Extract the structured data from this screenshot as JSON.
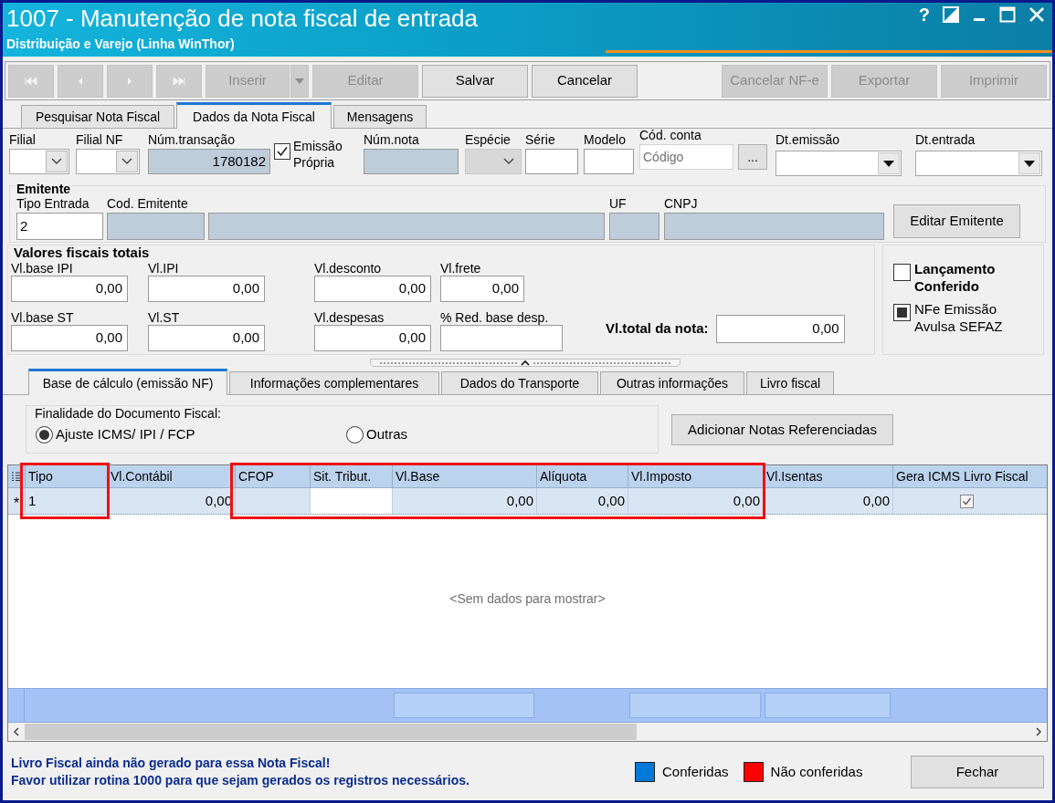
{
  "window": {
    "title": "1007 - Manutenção de nota fiscal de entrada",
    "subtitle": "Distribuição e Varejo (Linha WinThor)",
    "help": "?"
  },
  "toolbar_left": [
    {
      "kind": "first",
      "disabled": true
    },
    {
      "kind": "prev",
      "disabled": true
    },
    {
      "kind": "next",
      "disabled": true
    },
    {
      "kind": "last",
      "disabled": true
    },
    {
      "kind": "text",
      "label": "Inserir",
      "disabled": true,
      "dropdown": true
    },
    {
      "kind": "text",
      "label": "Editar",
      "disabled": true
    },
    {
      "kind": "text",
      "label": "Salvar",
      "disabled": false
    },
    {
      "kind": "text",
      "label": "Cancelar",
      "disabled": false
    }
  ],
  "toolbar_right": [
    {
      "kind": "text",
      "label": "Cancelar NF-e",
      "disabled": true
    },
    {
      "kind": "text",
      "label": "Exportar",
      "disabled": true
    },
    {
      "kind": "text",
      "label": "Imprimir",
      "disabled": true
    }
  ],
  "tabs": [
    {
      "label": "Pesquisar Nota Fiscal",
      "selected": false
    },
    {
      "label": "Dados da Nota Fiscal",
      "selected": true
    },
    {
      "label": "Mensagens",
      "selected": false
    }
  ],
  "header_fields": [
    {
      "kind": "combo",
      "label": "Filial",
      "disabled": false
    },
    {
      "kind": "combo",
      "label": "Filial NF",
      "disabled": false
    },
    {
      "kind": "text",
      "label": "Núm.transação",
      "value": "1780182",
      "readonly": true
    },
    {
      "kind": "check",
      "label": "Emissão Própria",
      "checked": true
    },
    {
      "kind": "text",
      "label": "Núm.nota",
      "readonly": true
    },
    {
      "kind": "combo",
      "label": "Espécie",
      "disabled": true
    },
    {
      "kind": "text",
      "label": "Série",
      "readonly": false
    },
    {
      "kind": "text",
      "label": "Modelo",
      "readonly": false
    },
    {
      "kind": "lookup",
      "label": "Cód. conta",
      "placeholder": "Código",
      "button": "..."
    },
    {
      "kind": "date",
      "label": "Dt.emissão"
    },
    {
      "kind": "date",
      "label": "Dt.entrada"
    }
  ],
  "emitente": {
    "title": "Emitente",
    "fields": [
      {
        "label": "Tipo Entrada",
        "value": "2",
        "readonly": false
      },
      {
        "label": "Cod. Emitente",
        "readonly": true
      },
      {
        "readonly": true
      },
      {
        "label": "UF",
        "readonly": true
      },
      {
        "label": "CNPJ",
        "readonly": true
      }
    ],
    "button": "Editar Emitente"
  },
  "valores": {
    "title": "Valores fiscais totais",
    "fields": [
      {
        "label": "Vl.base IPI",
        "value": "0,00"
      },
      {
        "label": "Vl.IPI",
        "value": "0,00"
      },
      {
        "label": "Vl.desconto",
        "value": "0,00"
      },
      {
        "label": "Vl.frete",
        "value": "0,00"
      },
      {
        "label": "Vl.base ST",
        "value": "0,00"
      },
      {
        "label": "Vl.ST",
        "value": "0,00"
      },
      {
        "label": "Vl.despesas",
        "value": "0,00"
      },
      {
        "label": "% Red. base desp."
      }
    ],
    "total_label": "Vl.total da nota:",
    "total_value": "0,00"
  },
  "flags": [
    {
      "kind": "check",
      "label": "Lançamento Conferido",
      "checked": false
    },
    {
      "kind": "fill",
      "label": "NFe Emissão Avulsa SEFAZ",
      "checked": true
    }
  ],
  "inner_tabs": [
    {
      "label": "Base de cálculo (emissão NF)",
      "selected": true
    },
    {
      "label": "Informações complementares",
      "selected": false
    },
    {
      "label": "Dados do Transporte",
      "selected": false
    },
    {
      "label": "Outras informações",
      "selected": false
    },
    {
      "label": "Livro fiscal",
      "selected": false
    }
  ],
  "finalidade": {
    "title": "Finalidade do Documento Fiscal:",
    "options": [
      {
        "label": "Ajuste ICMS/ IPI / FCP",
        "selected": true
      },
      {
        "label": "Outras",
        "selected": false
      }
    ]
  },
  "add_button": "Adicionar Notas Referenciadas",
  "grid": {
    "columns": [
      {
        "label": "Tipo",
        "highlighted": true,
        "summary": false
      },
      {
        "label": "Vl.Contábil",
        "highlighted": false,
        "summary": false
      },
      {
        "label": "CFOP",
        "highlighted": true,
        "summary": false
      },
      {
        "label": "Sit. Tribut.",
        "highlighted": true,
        "summary": false
      },
      {
        "label": "Vl.Base",
        "highlighted": true,
        "summary": true
      },
      {
        "label": "Alíquota",
        "highlighted": true,
        "summary": false
      },
      {
        "label": "Vl.Imposto",
        "highlighted": true,
        "summary": true
      },
      {
        "label": "Vl.Isentas",
        "highlighted": false,
        "summary": true
      },
      {
        "label": "Gera ICMS Livro Fiscal",
        "highlighted": false,
        "summary": false
      }
    ],
    "new_row": {
      "marker": "*",
      "cells": [
        {
          "kind": "text",
          "value": "1"
        },
        {
          "kind": "text",
          "value": "0,00"
        },
        {
          "kind": "text"
        },
        {
          "kind": "text",
          "focused": true
        },
        {
          "kind": "text",
          "value": "0,00"
        },
        {
          "kind": "text",
          "value": "0,00"
        },
        {
          "kind": "text",
          "value": "0,00"
        },
        {
          "kind": "text",
          "value": "0,00"
        },
        {
          "kind": "check",
          "checked": true
        }
      ]
    },
    "empty_text": "<Sem dados para mostrar>"
  },
  "messages": [
    "Livro Fiscal ainda não gerado para essa Nota Fiscal!",
    "Favor utilizar rotina 1000 para que sejam gerados os registros necessários."
  ],
  "legend": [
    {
      "label": "Conferidas",
      "color": "#0078d7"
    },
    {
      "label": "Não conferidas",
      "color": "#ff0000"
    }
  ],
  "close_button": "Fechar"
}
